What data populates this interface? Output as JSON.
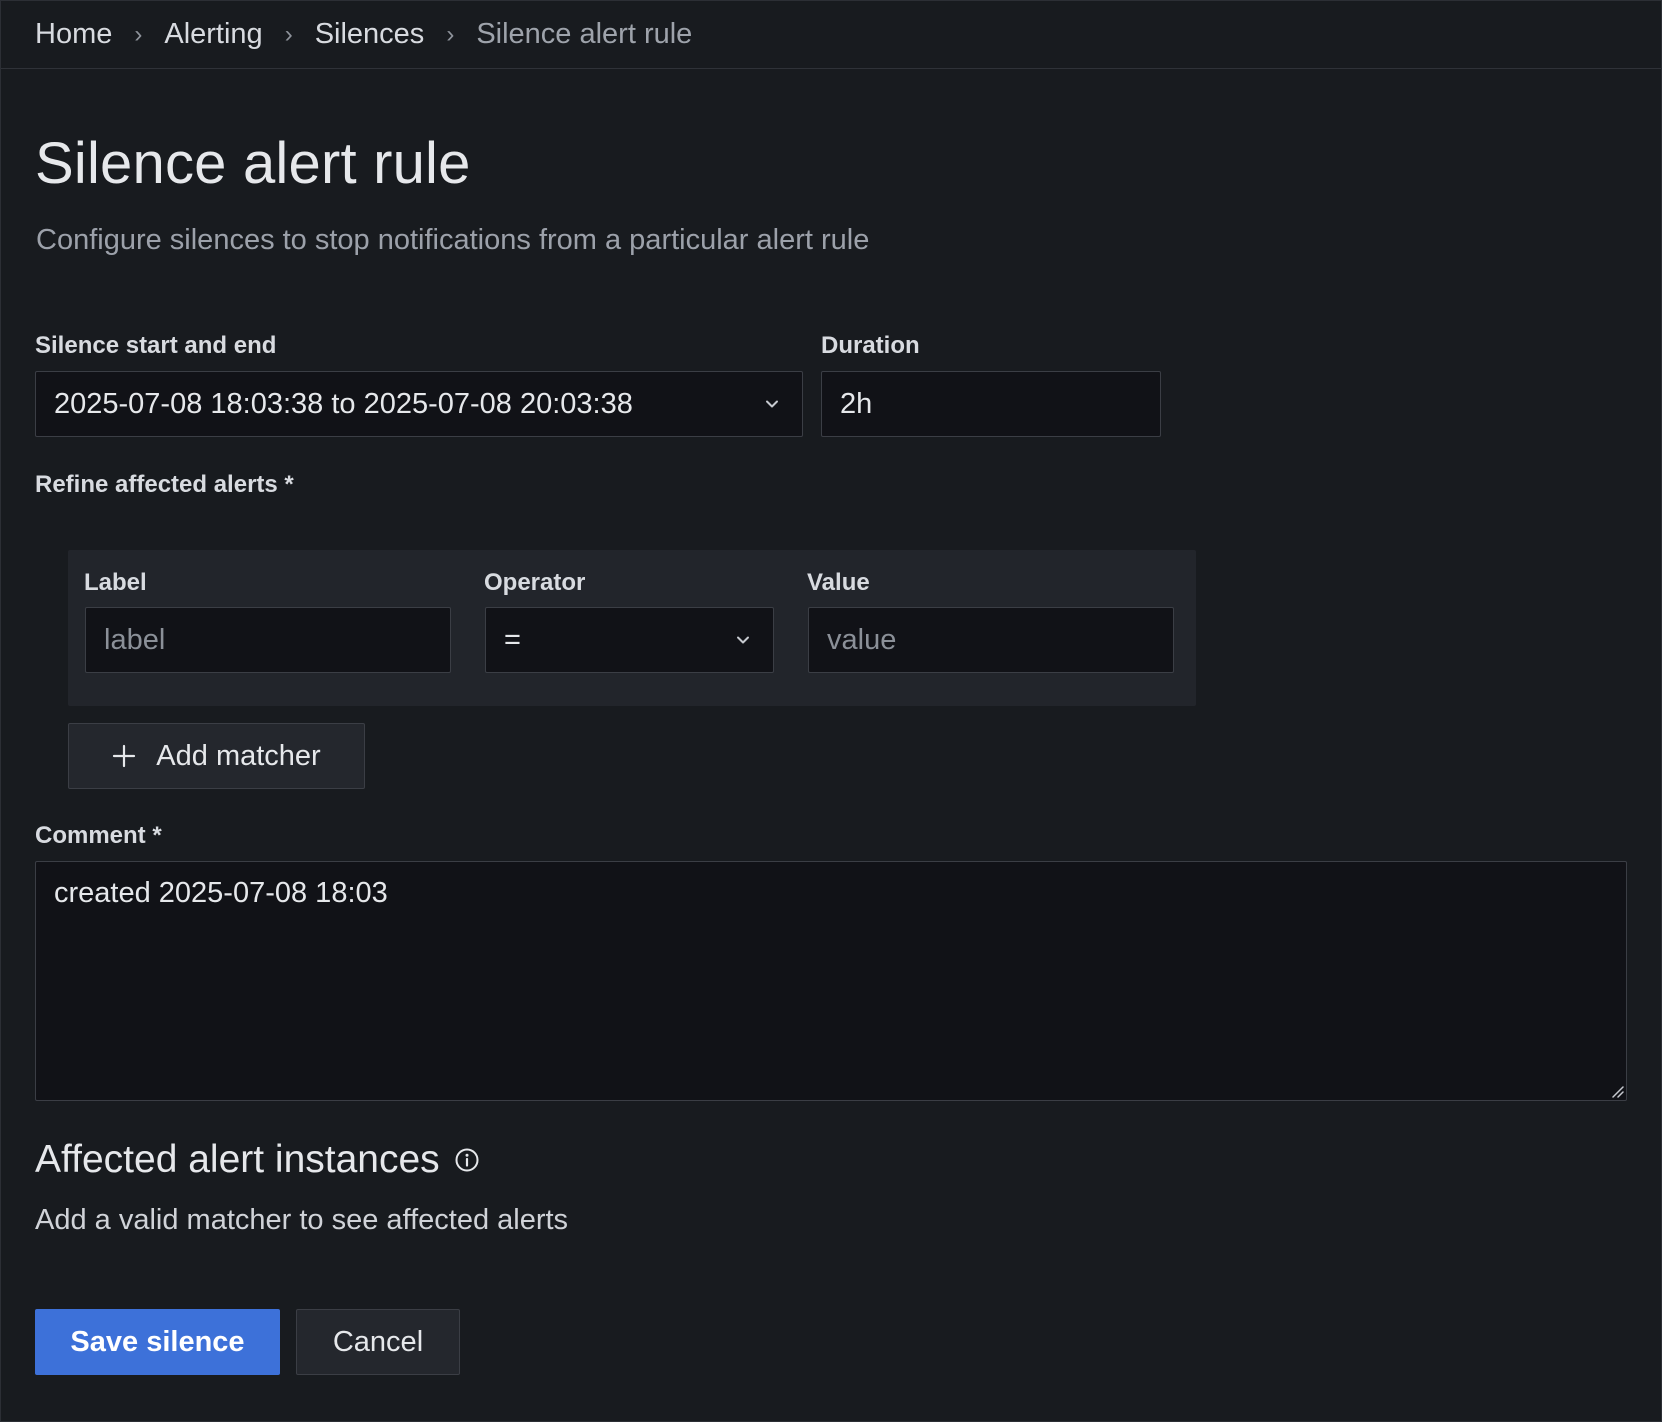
{
  "breadcrumb": {
    "items": [
      "Home",
      "Alerting",
      "Silences"
    ],
    "current": "Silence alert rule",
    "separator": "›"
  },
  "page": {
    "title": "Silence alert rule",
    "subtitle": "Configure silences to stop notifications from a particular alert rule"
  },
  "form": {
    "range_label": "Silence start and end",
    "range_value": "2025-07-08 18:03:38 to 2025-07-08 20:03:38",
    "duration_label": "Duration",
    "duration_value": "2h",
    "refine_label": "Refine affected alerts *",
    "matcher": {
      "label_header": "Label",
      "label_placeholder": "label",
      "operator_header": "Operator",
      "operator_value": "=",
      "value_header": "Value",
      "value_placeholder": "value"
    },
    "add_matcher_label": "Add matcher",
    "comment_label": "Comment *",
    "comment_value": "created 2025-07-08 18:03"
  },
  "affected": {
    "title": "Affected alert instances",
    "hint": "Add a valid matcher to see affected alerts"
  },
  "actions": {
    "save_label": "Save silence",
    "cancel_label": "Cancel"
  },
  "colors": {
    "background": "#181b1f",
    "input_bg": "#111217",
    "primary": "#3d71d9"
  },
  "icons": [
    "chevron-right-icon",
    "chevron-down-icon",
    "plus-icon",
    "info-icon",
    "resize-handle-icon"
  ]
}
